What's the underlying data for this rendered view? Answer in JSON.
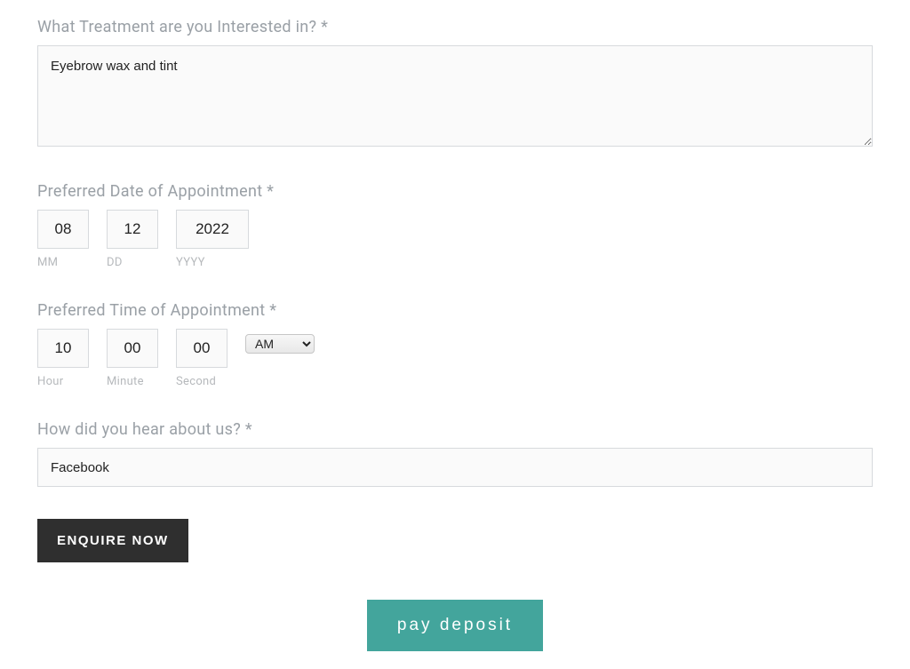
{
  "treatment": {
    "label": "What Treatment are you Interested in? *",
    "value": "Eyebrow wax and tint"
  },
  "preferred_date": {
    "label": "Preferred Date of Appointment *",
    "mm": {
      "value": "08",
      "sublabel": "MM"
    },
    "dd": {
      "value": "12",
      "sublabel": "DD"
    },
    "yyyy": {
      "value": "2022",
      "sublabel": "YYYY"
    }
  },
  "preferred_time": {
    "label": "Preferred Time of Appointment *",
    "hour": {
      "value": "10",
      "sublabel": "Hour"
    },
    "minute": {
      "value": "00",
      "sublabel": "Minute"
    },
    "second": {
      "value": "00",
      "sublabel": "Second"
    },
    "ampm": "AM"
  },
  "hear_about": {
    "label": "How did you hear about us? *",
    "value": "Facebook"
  },
  "buttons": {
    "enquire": "ENQUIRE NOW",
    "deposit": "pay deposit"
  }
}
